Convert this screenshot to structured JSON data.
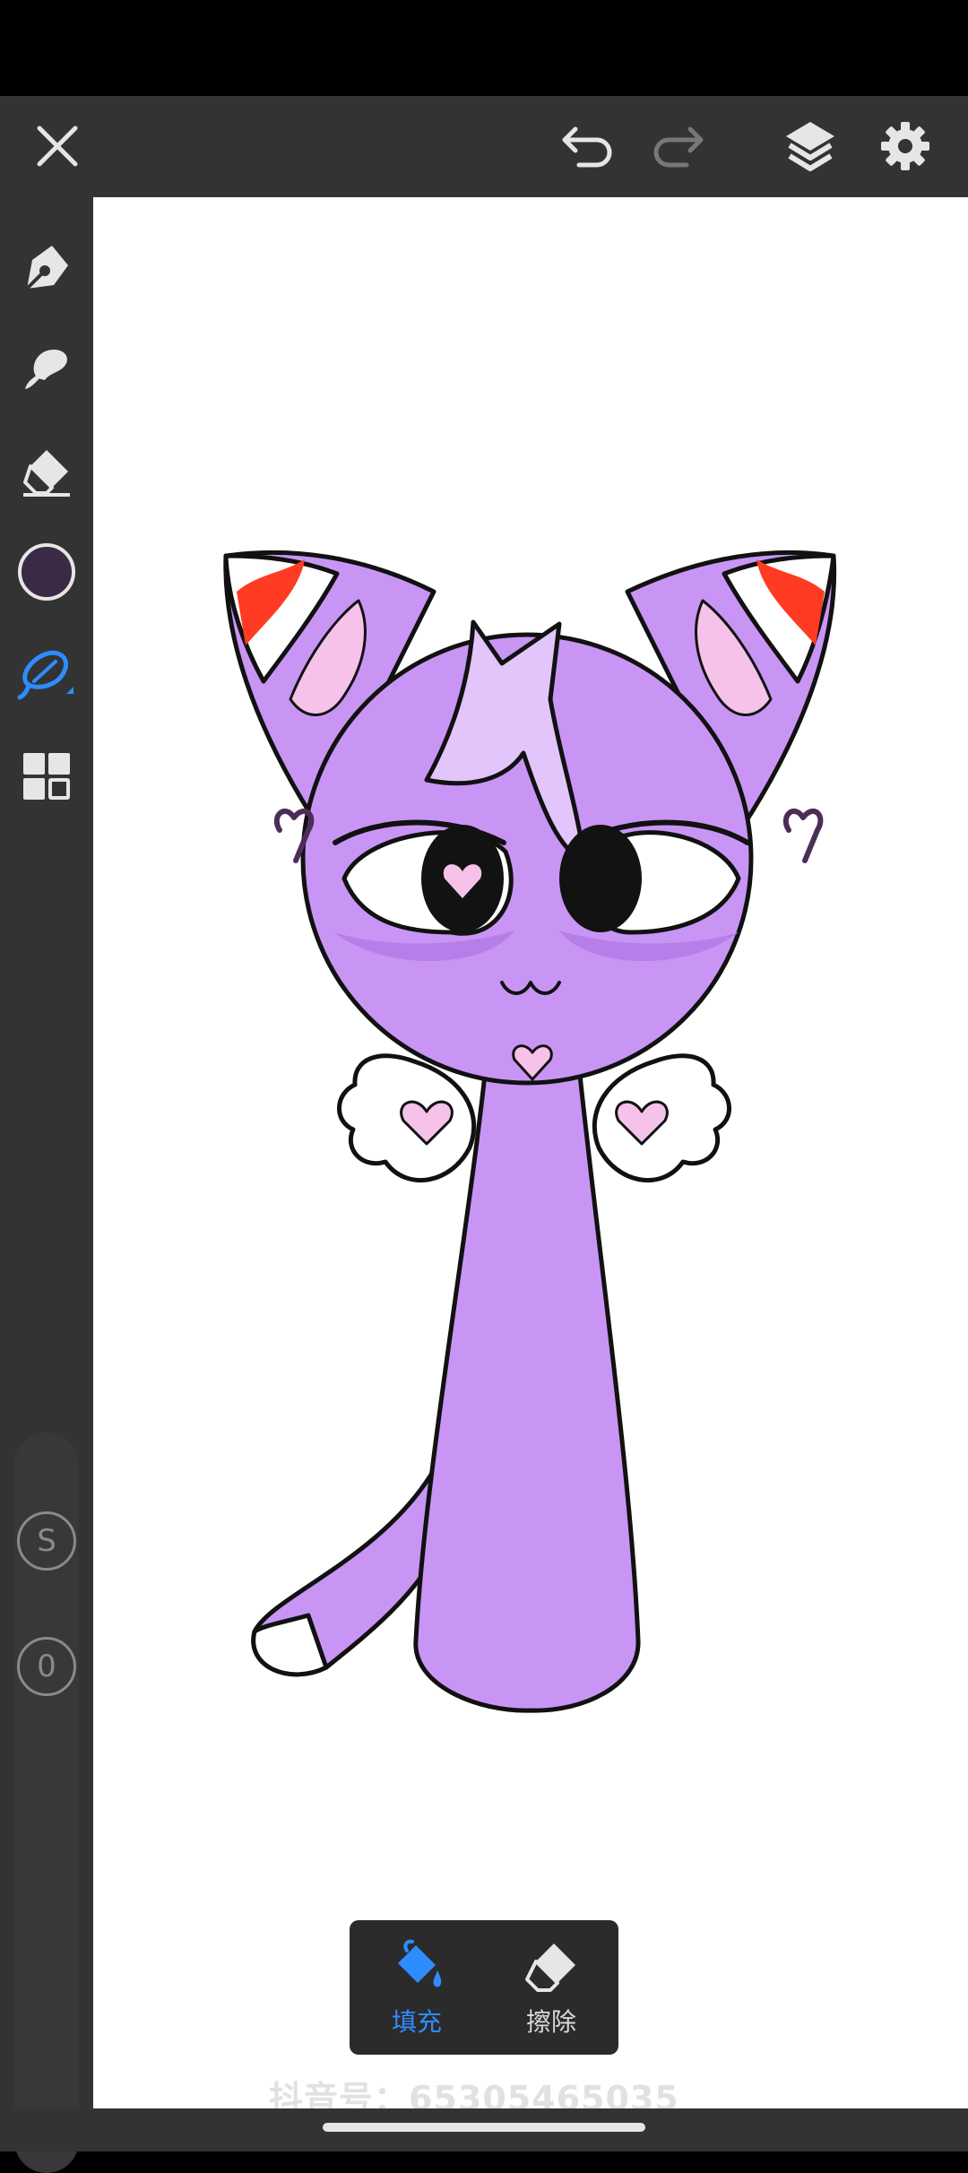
{
  "toolbar": {
    "close_icon": "close-icon",
    "undo_icon": "undo-icon",
    "redo_icon": "redo-icon",
    "layers_icon": "layers-icon",
    "settings_icon": "gear-icon"
  },
  "left_tools": {
    "pen_icon": "pen-icon",
    "smudge_icon": "smudge-brush-icon",
    "eraser_icon": "eraser-icon",
    "current_color": "#3a2a45",
    "fill_icon": "fill-lasso-icon",
    "grid_icon": "grid-icon",
    "size_badge": "S",
    "opacity_badge": "0"
  },
  "bottom_tools": {
    "fill": {
      "label": "填充",
      "active": true,
      "color": "#2f8cff"
    },
    "erase": {
      "label": "擦除",
      "active": false,
      "color": "#d9d9d9"
    }
  },
  "watermark": "抖音号：65305465035",
  "colors": {
    "chrome": "#333333",
    "accent": "#2f8cff",
    "character_purple": "#c995f5"
  }
}
